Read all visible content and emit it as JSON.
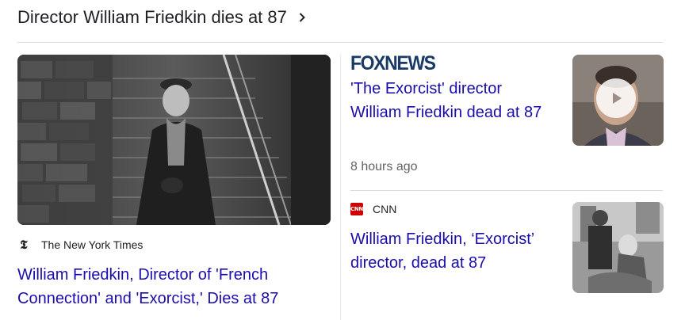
{
  "topic": {
    "title": "Director William Friedkin dies at 87"
  },
  "main_story": {
    "source": "The New York Times",
    "headline": "William Friedkin, Director of 'French Connection' and 'Exorcist,' Dies at 87"
  },
  "fox_story": {
    "source_logo_text": "FOXNEWS",
    "headline": "'The Exorcist' director William Friedkin dead at 87",
    "time": "8 hours ago"
  },
  "cnn_story": {
    "source_logo_text": "CNN",
    "source": "CNN",
    "headline": "William Friedkin, ‘Exorcist’ director, dead at 87"
  },
  "icons": {
    "topic_more": "chevron-right-icon",
    "video_play": "play-icon",
    "nyt": "nyt-logo-icon"
  },
  "colors": {
    "link": "#1a0dab",
    "fox_navy": "#1a3a66",
    "cnn_red": "#cc0000",
    "muted": "#5f6368"
  }
}
